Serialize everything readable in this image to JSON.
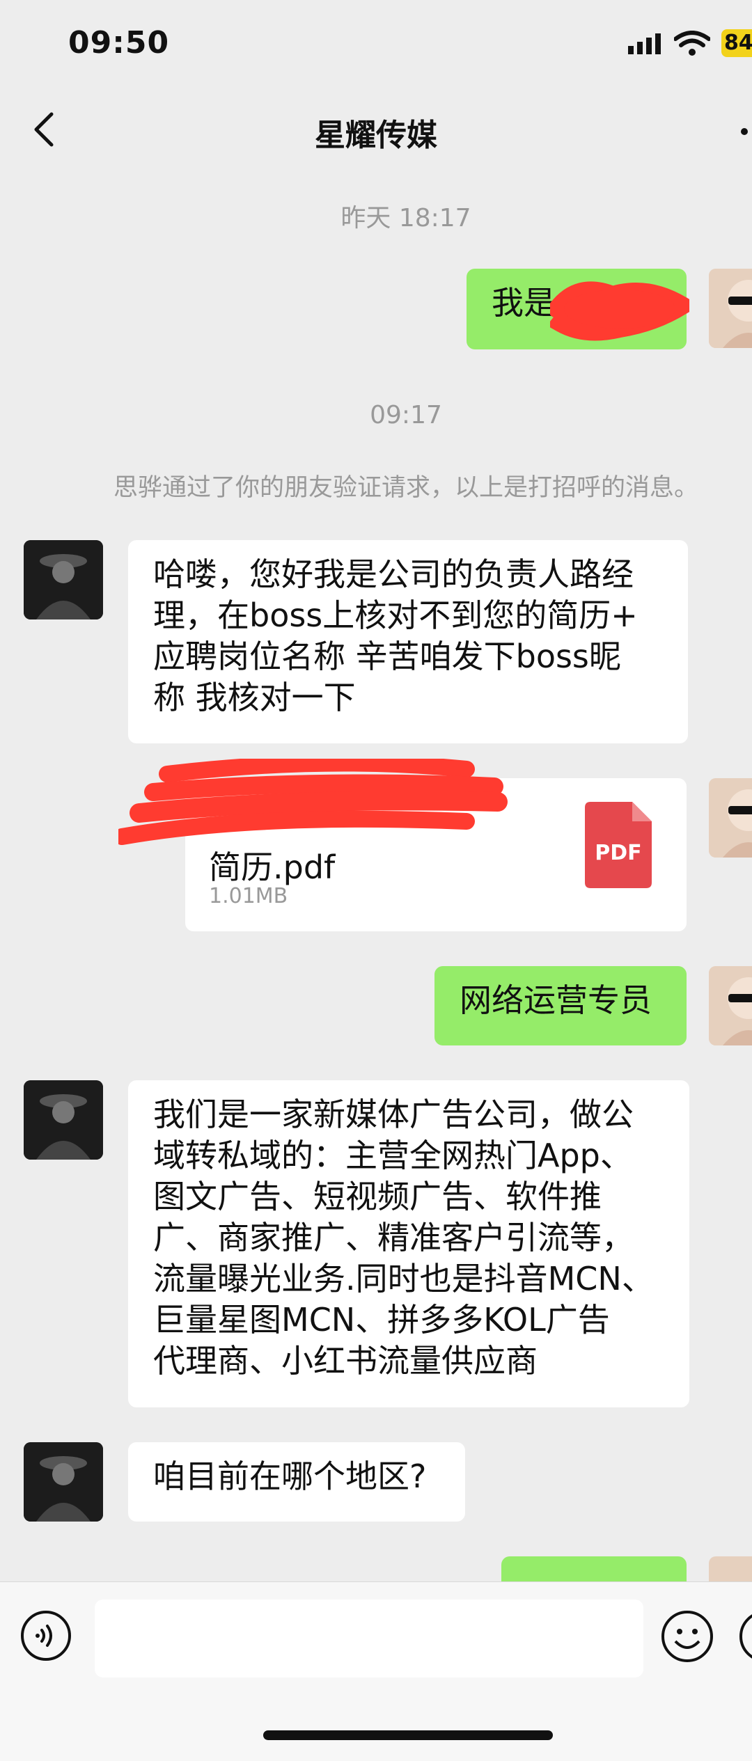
{
  "status_bar": {
    "time": "09:50",
    "battery": "84"
  },
  "header": {
    "title": "星耀传媒"
  },
  "messages": {
    "ts1": "昨天 18:17",
    "msg1": "我是",
    "ts2": "09:17",
    "system": "思骅通过了你的朋友验证请求，以上是打招呼的消息。",
    "msg2_lines": [
      "哈喽，您好我是公司的负责人路经",
      "理，在boss上核对不到您的简历+",
      "应聘岗位名称  辛苦咱发下boss昵",
      "称  我核对一下"
    ],
    "file": {
      "name_visible": "简历.pdf",
      "size": "1.01MB",
      "badge": "PDF"
    },
    "msg3": "网络运营专员",
    "msg4_lines": [
      "我们是一家新媒体广告公司，做公",
      "域转私域的：主营全网热门App、",
      "图文广告、短视频广告、软件推",
      "广、商家推广、精准客户引流等，",
      "流量曝光业务.同时也是抖音MCN、",
      "巨量星图MCN、拼多多KOL广告",
      "代理商、小红书流量供应商"
    ],
    "msg5": "咱目前在哪个地区?"
  },
  "colors": {
    "green_bubble": "#95ec69",
    "background": "#ededed",
    "pdf_red": "#e5484d",
    "redaction": "#ff3b30"
  },
  "icons": [
    "back-icon",
    "more-icon",
    "signal-icon",
    "wifi-icon",
    "battery-icon",
    "pdf-icon",
    "voice-icon",
    "emoji-icon",
    "plus-icon"
  ]
}
